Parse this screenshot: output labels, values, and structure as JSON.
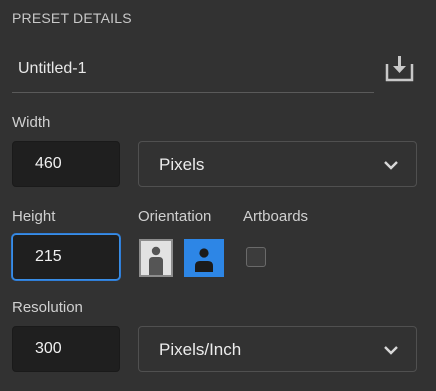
{
  "preset": {
    "section_title": "PRESET DETAILS",
    "name": "Untitled-1",
    "save_icon": "save-preset-icon"
  },
  "width": {
    "label": "Width",
    "value": "460",
    "unit": "Pixels"
  },
  "height": {
    "label": "Height",
    "value": "215"
  },
  "orientation": {
    "label": "Orientation",
    "selected": "landscape",
    "options": [
      "portrait",
      "landscape"
    ]
  },
  "artboards": {
    "label": "Artboards",
    "checked": false
  },
  "resolution": {
    "label": "Resolution",
    "value": "300",
    "unit": "Pixels/Inch"
  },
  "colors": {
    "background": "#323232",
    "field": "#1f1f1f",
    "accent": "#2d86e6"
  }
}
